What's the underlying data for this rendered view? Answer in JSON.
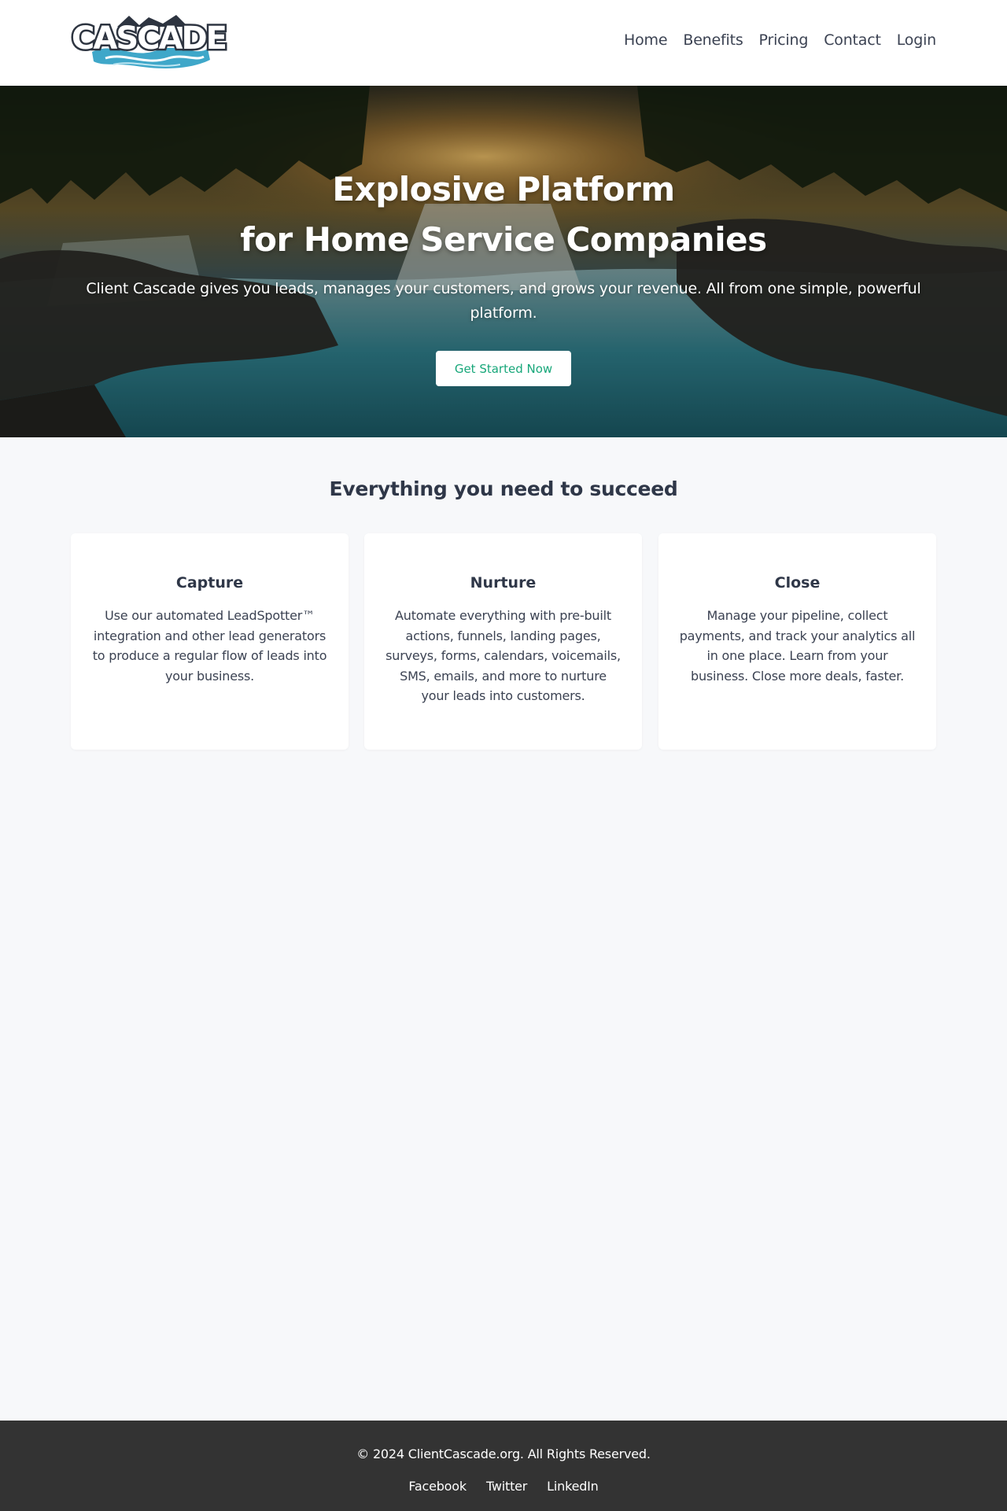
{
  "header": {
    "logo_text": "CASCADE",
    "nav": [
      {
        "label": "Home"
      },
      {
        "label": "Benefits"
      },
      {
        "label": "Pricing"
      },
      {
        "label": "Contact"
      },
      {
        "label": "Login"
      }
    ]
  },
  "hero": {
    "title_line1": "Explosive Platform",
    "title_line2": "for Home Service Companies",
    "subtitle": "Client Cascade gives you leads, manages your customers, and grows your revenue. All from one simple, powerful platform.",
    "cta_label": "Get Started Now"
  },
  "features": {
    "title": "Everything you need to succeed",
    "cards": [
      {
        "title": "Capture",
        "text": "Use our automated LeadSpotter™ integration and other lead generators to produce a regular flow of leads into your business."
      },
      {
        "title": "Nurture",
        "text": "Automate everything with pre-built actions, funnels, landing pages, surveys, forms, calendars, voicemails, SMS, emails, and more to nurture your leads into customers."
      },
      {
        "title": "Close",
        "text": "Manage your pipeline, collect payments, and track your analytics all in one place. Learn from your business. Close more deals, faster."
      }
    ]
  },
  "footer": {
    "copyright": "© 2024 ClientCascade.org. All Rights Reserved.",
    "social": [
      {
        "label": "Facebook"
      },
      {
        "label": "Twitter"
      },
      {
        "label": "LinkedIn"
      }
    ]
  },
  "colors": {
    "accent": "#18a77a",
    "logo_blue": "#3fa7c9",
    "footer_bg": "#333333",
    "page_bg": "#f7f8fa"
  }
}
